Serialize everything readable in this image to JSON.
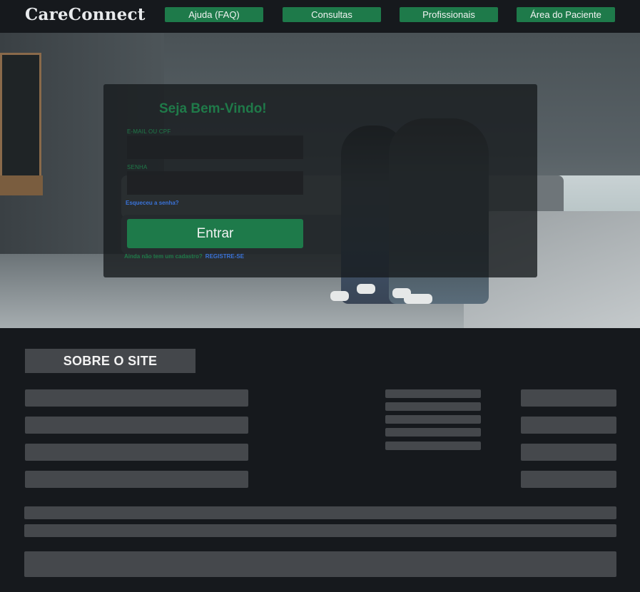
{
  "header": {
    "brand": "CareConnect",
    "nav": [
      "Ajuda (FAQ)",
      "Consultas",
      "Profissionais",
      "Área do Paciente"
    ]
  },
  "login": {
    "title": "Seja Bem-Vindo!",
    "email_label": "E-MAIL OU CPF",
    "email_value": "",
    "password_label": "SENHA",
    "password_value": "",
    "forgot": "Esqueceu a senha?",
    "submit": "Entrar",
    "signup_question": "Ainda não tem um cadastro?",
    "signup_link": "REGISTRE-SE"
  },
  "about": {
    "title": "SOBRE O SITE"
  },
  "colors": {
    "accent": "#1e7a4a",
    "link": "#3a73d9",
    "background": "#16191d",
    "placeholder_bar": "#45484c"
  }
}
